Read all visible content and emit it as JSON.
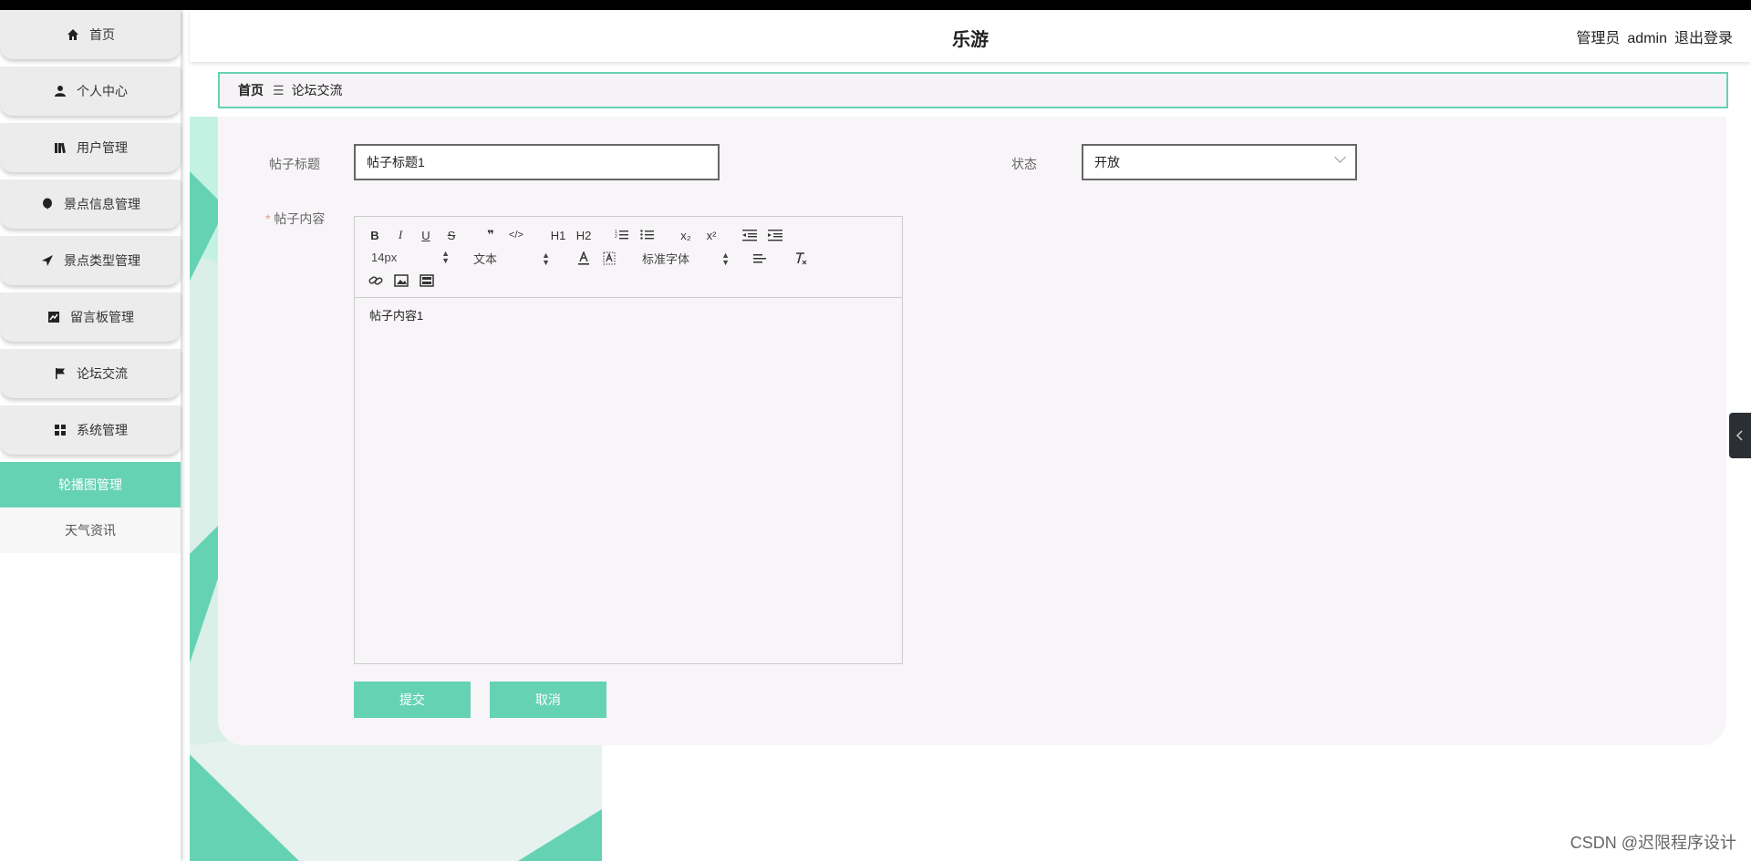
{
  "header": {
    "app_title": "乐游",
    "role": "管理员",
    "username": "admin",
    "logout_label": "退出登录"
  },
  "sidebar": {
    "items": [
      {
        "label": "首页",
        "icon": "home-icon"
      },
      {
        "label": "个人中心",
        "icon": "user-icon"
      },
      {
        "label": "用户管理",
        "icon": "books-icon"
      },
      {
        "label": "景点信息管理",
        "icon": "balloon-icon"
      },
      {
        "label": "景点类型管理",
        "icon": "send-icon"
      },
      {
        "label": "留言板管理",
        "icon": "chart-icon"
      },
      {
        "label": "论坛交流",
        "icon": "flag-icon"
      },
      {
        "label": "系统管理",
        "icon": "grid-icon"
      }
    ],
    "sub_items": [
      {
        "label": "轮播图管理",
        "active": true
      },
      {
        "label": "天气资讯",
        "active": false
      }
    ]
  },
  "breadcrumb": {
    "home": "首页",
    "separator": "☰",
    "current": "论坛交流"
  },
  "form": {
    "title_label": "帖子标题",
    "title_value": "帖子标题1",
    "status_label": "状态",
    "status_value": "开放",
    "content_required_mark": "*",
    "content_label": "帖子内容",
    "content_value": "帖子内容1",
    "submit_label": "提交",
    "cancel_label": "取消"
  },
  "editor": {
    "font_size": "14px",
    "text_type": "文本",
    "font_family": "标准字体",
    "buttons": [
      "B",
      "I",
      "U",
      "S",
      "❞",
      "</>",
      "H1",
      "H2",
      "ordered-list",
      "bullet-list",
      "x₂",
      "x²",
      "outdent",
      "indent"
    ]
  },
  "watermark": "CSDN @迟限程序设计",
  "colors": {
    "accent": "#66d2b4",
    "sidebar_bg": "#ececec",
    "panel_bg": "#f8f5f8"
  }
}
